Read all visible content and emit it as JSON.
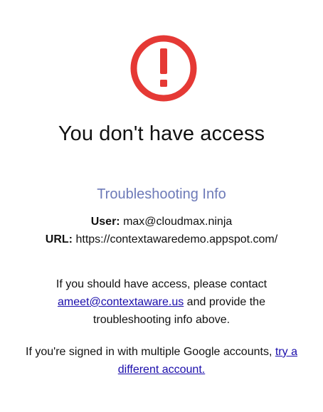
{
  "icon": {
    "name": "alert-icon",
    "color": "#e53935"
  },
  "title": "You don't have access",
  "troubleshooting": {
    "heading": "Troubleshooting Info",
    "user_label": "User:",
    "user_value": "max@cloudmax.ninja",
    "url_label": "URL:",
    "url_value": "https://contextawaredemo.appspot.com/"
  },
  "contact": {
    "text_before": "If you should have access, please contact",
    "email_link": "ameet@contextaware.us",
    "text_after": "and provide the troubleshooting info above."
  },
  "multiple_accounts": {
    "text_before": "If you're signed in with multiple Google accounts,",
    "link": "try a different account."
  },
  "colors": {
    "accent_heading": "#6d7ab8",
    "link": "#1a0dab",
    "alert": "#e53935"
  }
}
